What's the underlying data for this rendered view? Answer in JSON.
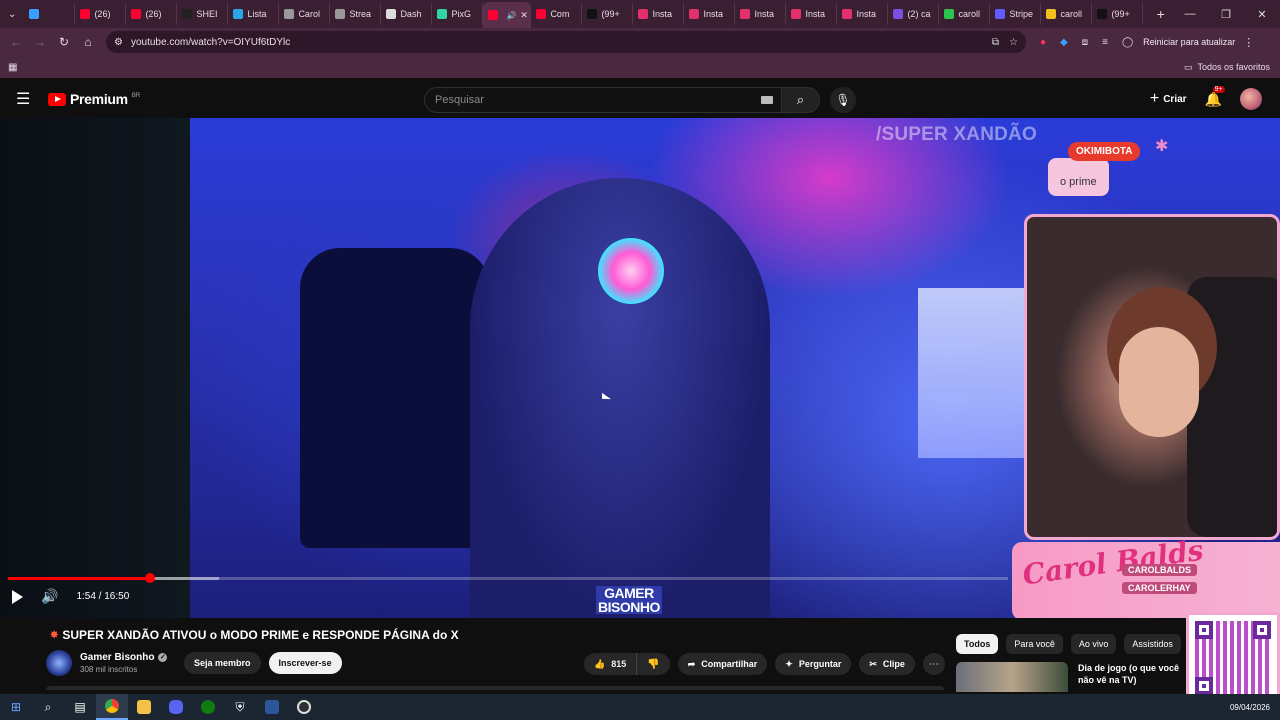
{
  "browser": {
    "tabs": [
      {
        "label": "",
        "color": "#3aa0ff"
      },
      {
        "label": "(26)",
        "color": "#ff0033"
      },
      {
        "label": "(26)",
        "color": "#ff0033"
      },
      {
        "label": "SHEI",
        "color": "#222222"
      },
      {
        "label": "Lista",
        "color": "#2aa6e8"
      },
      {
        "label": "Carol",
        "color": "#999999"
      },
      {
        "label": "Strea",
        "color": "#999999"
      },
      {
        "label": "Dash",
        "color": "#dddddd"
      },
      {
        "label": "PixG",
        "color": "#32d4a4"
      },
      {
        "label": "",
        "color": "#ff0033",
        "active": true
      },
      {
        "label": "Com",
        "color": "#ff0033"
      },
      {
        "label": "(99+",
        "color": "#111111"
      },
      {
        "label": "Insta",
        "color": "#e1306c"
      },
      {
        "label": "Insta",
        "color": "#e1306c"
      },
      {
        "label": "Insta",
        "color": "#e1306c"
      },
      {
        "label": "Insta",
        "color": "#e1306c"
      },
      {
        "label": "Insta",
        "color": "#e1306c"
      },
      {
        "label": "(2) ca",
        "color": "#7b4fe0"
      },
      {
        "label": "caroll",
        "color": "#2cc44e"
      },
      {
        "label": "Stripe",
        "color": "#635bff"
      },
      {
        "label": "caroll",
        "color": "#f4c21b"
      },
      {
        "label": "(99+",
        "color": "#111111"
      }
    ],
    "url": "youtube.com/watch?v=OIYUf6tDYlc",
    "update_label": "Reiniciar para atualizar",
    "bookmarks_label": "Todos os favoritos"
  },
  "youtube": {
    "logo_text": "Premium",
    "logo_country": "BR",
    "search_placeholder": "Pesquisar",
    "create_label": "Criar",
    "notifications_badge": "9+"
  },
  "video": {
    "overlay_watermark": "/SUPER XANDÃO",
    "chat_user": "OKIMIBOTA",
    "chat_message": "o prime",
    "brand_logo": "Carol Balds",
    "brand_handle_1": "CAROLBALDS",
    "brand_handle_2": "CAROLERHAY",
    "channel_overlay_line1": "GAMER",
    "channel_overlay_line2": "BISONHO",
    "time_current": "1:54",
    "time_total": "16:50",
    "time_display": "1:54 / 16:50",
    "progress_played": 0.142,
    "progress_buffered": 0.211
  },
  "meta": {
    "title": "SUPER XANDÃO ATIVOU o MODO PRIME e RESPONDE PÁGINA do X",
    "channel_name": "Gamer Bisonho",
    "subscribers": "308 mil inscritos",
    "join_label": "Seja membro",
    "subscribe_label": "Inscrever-se",
    "likes": "815",
    "share_label": "Compartilhar",
    "ask_label": "Perguntar",
    "clip_label": "Clipe"
  },
  "sidebar": {
    "chips": [
      {
        "label": "Todos",
        "active": true
      },
      {
        "label": "Para você"
      },
      {
        "label": "Ao vivo"
      },
      {
        "label": "Assistidos"
      }
    ],
    "rec_title": "Dia de jogo (o que você não vê na TV)"
  },
  "taskbar": {
    "date": "09/04/2026"
  }
}
